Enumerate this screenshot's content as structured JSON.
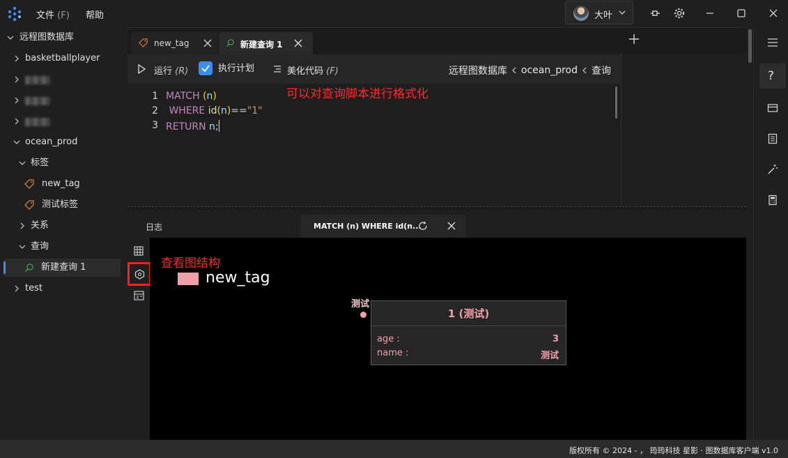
{
  "titlebar": {
    "menu": [
      {
        "label": "文件",
        "mnemonic": "(F)"
      },
      {
        "label": "帮助"
      }
    ],
    "user_name": "大叶"
  },
  "sidebar": {
    "root": "远程图数据库",
    "items": [
      {
        "label": "basketballplayer"
      },
      {
        "label": "ocean_prod"
      },
      {
        "label": "标签"
      },
      {
        "label": "new_tag"
      },
      {
        "label": "测试标签"
      },
      {
        "label": "关系"
      },
      {
        "label": "查询"
      },
      {
        "label": "新建查询 1"
      },
      {
        "label": "test"
      }
    ]
  },
  "editor": {
    "tabs": [
      {
        "label": "new_tag"
      },
      {
        "label": "新建查询 1"
      }
    ],
    "toolbar": {
      "run_label": "运行",
      "run_mnemonic": "(R)",
      "plan_label": "执行计划",
      "beautify_label": "美化代码",
      "beautify_mnemonic": "(F)"
    },
    "breadcrumb": [
      "远程图数据库",
      "ocean_prod",
      "查询"
    ],
    "code_lines": [
      {
        "no": "1",
        "kw": "MATCH",
        "rest1": "(",
        "var": "n",
        "rest2": ")"
      },
      {
        "no": "2",
        "kw": "WHERE",
        "fn": "id",
        "rest1": "(",
        "var": "n",
        "rest2": ")",
        "op": "==",
        "str": "\"1\""
      },
      {
        "no": "3",
        "kw": "RETURN",
        "var": "n",
        "op": ";"
      }
    ]
  },
  "annotations": {
    "format_hint": "可以对查询脚本进行格式化",
    "graph_hint": "查看图结构"
  },
  "results": {
    "log_tab": "日志",
    "query_tab": "MATCH (n) WHERE id(n...",
    "legend_label": "new_tag",
    "legend_color": "#f0a0a8",
    "node_label": "测试",
    "popup": {
      "title": "1 (测试)",
      "props": [
        {
          "key": "age :",
          "value": "3"
        },
        {
          "key": "name :",
          "value": "测试"
        }
      ]
    }
  },
  "status": {
    "copyright": "版权所有 © 2024 - ， 筠筠科技  星影 · 图数据库客户端  v1.0"
  }
}
